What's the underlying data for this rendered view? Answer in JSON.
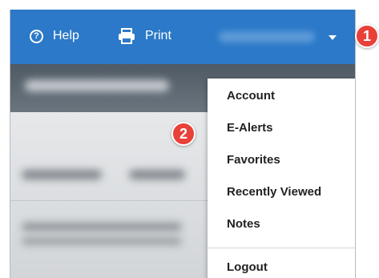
{
  "toolbar": {
    "help_label": "Help",
    "help_icon": "help-circle-icon",
    "print_label": "Print",
    "print_icon": "printer-icon",
    "user_menu_icon": "caret-down-icon"
  },
  "menu": {
    "items": [
      {
        "label": "Account"
      },
      {
        "label": "E-Alerts"
      },
      {
        "label": "Favorites"
      },
      {
        "label": "Recently Viewed"
      },
      {
        "label": "Notes"
      },
      {
        "label": "Logout"
      }
    ]
  },
  "callouts": {
    "badge_1": "1",
    "badge_2": "2"
  },
  "colors": {
    "topbar": "#2b79c8",
    "badge": "#e8413a"
  }
}
